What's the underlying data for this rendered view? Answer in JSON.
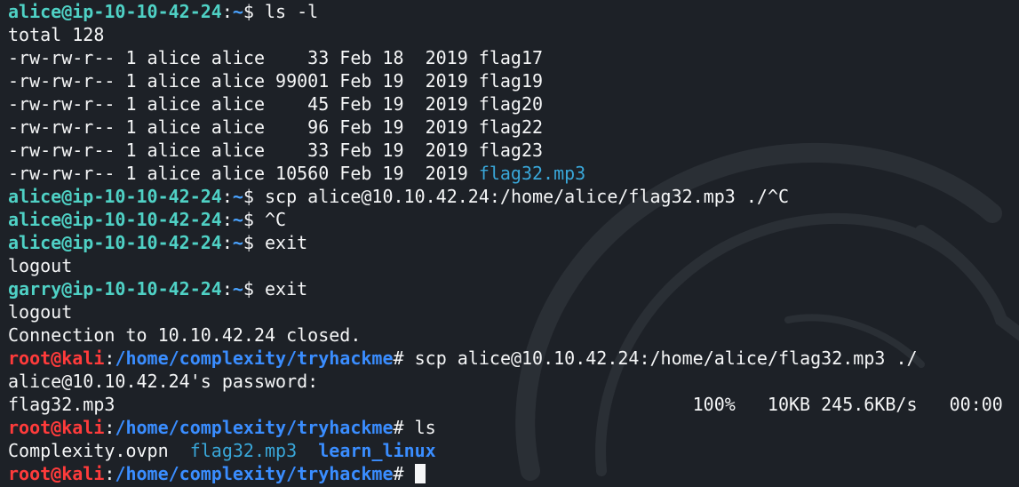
{
  "colors": {
    "background": "#1d2127",
    "text": "#f5f6f7",
    "user_prompt": "#4fd1c5",
    "root_prompt": "#ff3b3b",
    "path": "#3a8dff",
    "audio_file": "#39a7d9"
  },
  "terminal": {
    "l1": {
      "user": "alice@ip-10-10-42-24",
      "colon": ":",
      "path": "~",
      "sym": "$ ",
      "cmd": "ls -l"
    },
    "l2": "total 128",
    "l3": "-rw-rw-r-- 1 alice alice    33 Feb 18  2019 flag17",
    "l4": "-rw-rw-r-- 1 alice alice 99001 Feb 19  2019 flag19",
    "l5": "-rw-rw-r-- 1 alice alice    45 Feb 19  2019 flag20",
    "l6": "-rw-rw-r-- 1 alice alice    96 Feb 19  2019 flag22",
    "l7": "-rw-rw-r-- 1 alice alice    33 Feb 19  2019 flag23",
    "l8": {
      "prefix": "-rw-rw-r-- 1 alice alice 10560 Feb 19  2019 ",
      "file": "flag32.mp3"
    },
    "l9": {
      "user": "alice@ip-10-10-42-24",
      "colon": ":",
      "path": "~",
      "sym": "$ ",
      "cmd": "scp alice@10.10.42.24:/home/alice/flag32.mp3 ./^C"
    },
    "l10": {
      "user": "alice@ip-10-10-42-24",
      "colon": ":",
      "path": "~",
      "sym": "$ ",
      "cmd": "^C"
    },
    "l11": {
      "user": "alice@ip-10-10-42-24",
      "colon": ":",
      "path": "~",
      "sym": "$ ",
      "cmd": "exit"
    },
    "l12": "logout",
    "l13": {
      "user": "garry@ip-10-10-42-24",
      "colon": ":",
      "path": "~",
      "sym": "$ ",
      "cmd": "exit"
    },
    "l14": "logout",
    "l15": "Connection to 10.10.42.24 closed.",
    "l16": {
      "root": "root",
      "at": "@",
      "host": "kali",
      "colon": ":",
      "path": "/home/complexity/tryhackme",
      "sym": "# ",
      "cmd": "scp alice@10.10.42.24:/home/alice/flag32.mp3 ./"
    },
    "l17": "alice@10.10.42.24's password:",
    "l18": "flag32.mp3                                                      100%   10KB 245.6KB/s   00:00",
    "l19": {
      "root": "root",
      "at": "@",
      "host": "kali",
      "colon": ":",
      "path": "/home/complexity/tryhackme",
      "sym": "# ",
      "cmd": "ls"
    },
    "l20": {
      "f1": "Complexity.ovpn",
      "gap1": "  ",
      "f2": "flag32.mp3",
      "gap2": "  ",
      "f3": "learn_linux"
    },
    "l21": {
      "root": "root",
      "at": "@",
      "host": "kali",
      "colon": ":",
      "path": "/home/complexity/tryhackme",
      "sym": "# "
    }
  }
}
